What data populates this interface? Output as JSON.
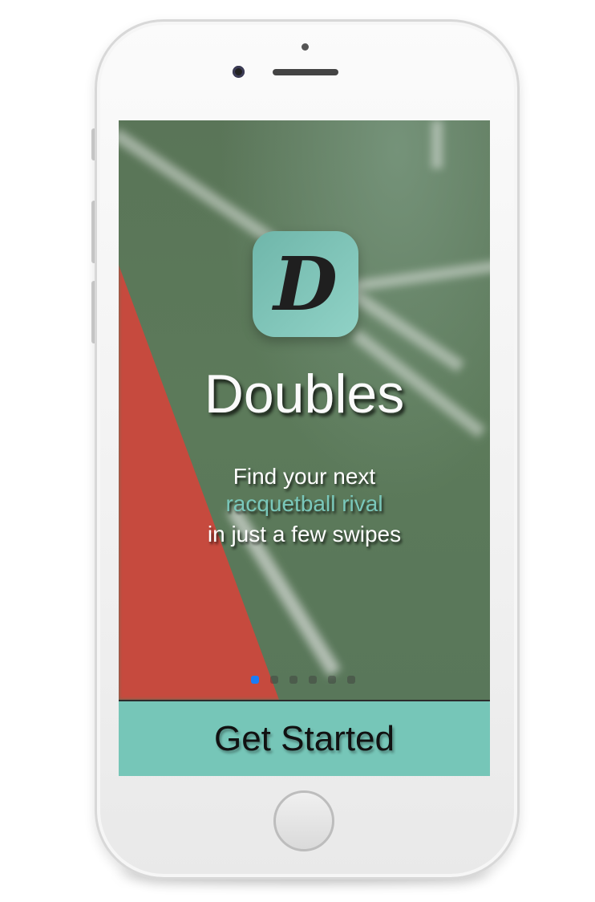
{
  "app": {
    "icon_letter": "D",
    "name": "Doubles",
    "tagline_line1": "Find your next",
    "tagline_highlight": "racquetball rival",
    "tagline_line3": "in just a few swipes"
  },
  "pager": {
    "total_pages": 6,
    "active_page": 1
  },
  "cta": {
    "label": "Get Started"
  },
  "colors": {
    "accent": "#76c6b8",
    "highlight_text": "#7ac8bb",
    "court_green": "#5b7657",
    "court_red": "#c64a3e",
    "page_dot_active": "#1a7cf5"
  }
}
